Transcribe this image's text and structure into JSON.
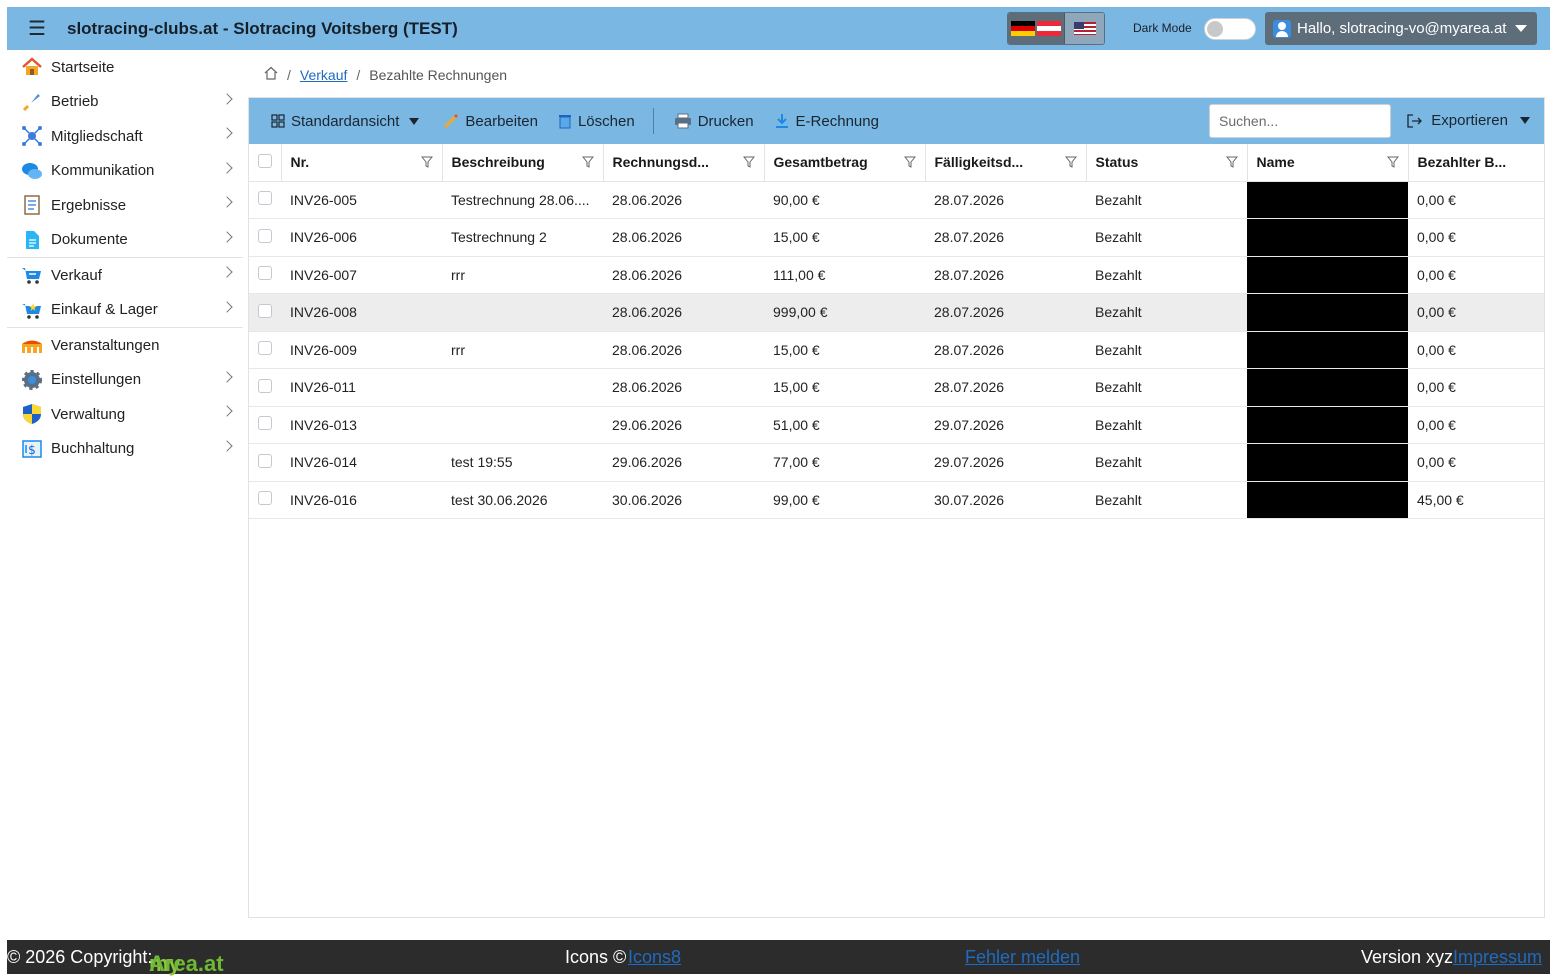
{
  "header": {
    "title": "slotracing-clubs.at - Slotracing Voitsberg (TEST)",
    "dark_mode_label": "Dark Mode",
    "user_label": "Hallo, slotracing-vo@myarea.at"
  },
  "sidebar": {
    "items": [
      {
        "label": "Startseite",
        "icon": "home-icon"
      },
      {
        "label": "Betrieb",
        "icon": "rocket-icon"
      },
      {
        "label": "Mitgliedschaft",
        "icon": "network-icon"
      },
      {
        "label": "Kommunikation",
        "icon": "chat-icon"
      },
      {
        "label": "Ergebnisse",
        "icon": "clipboard-icon"
      },
      {
        "label": "Dokumente",
        "icon": "document-icon"
      },
      {
        "label": "Verkauf",
        "icon": "cart-icon"
      },
      {
        "label": "Einkauf & Lager",
        "icon": "basket-icon"
      },
      {
        "label": "Veranstaltungen",
        "icon": "stadium-icon"
      },
      {
        "label": "Einstellungen",
        "icon": "gear-icon"
      },
      {
        "label": "Verwaltung",
        "icon": "shield-icon"
      },
      {
        "label": "Buchhaltung",
        "icon": "ledger-icon"
      }
    ]
  },
  "breadcrumb": {
    "parent": "Verkauf",
    "current": "Bezahlte Rechnungen"
  },
  "toolbar": {
    "view_label": "Standardansicht",
    "edit_label": "Bearbeiten",
    "delete_label": "Löschen",
    "print_label": "Drucken",
    "einvoice_label": "E-Rechnung",
    "search_placeholder": "Suchen...",
    "export_label": "Exportieren"
  },
  "table": {
    "columns": [
      "Nr.",
      "Beschreibung",
      "Rechnungsd...",
      "Gesamtbetrag",
      "Fälligkeitsd...",
      "Status",
      "Name",
      "Bezahlter B..."
    ],
    "rows": [
      {
        "nr": "INV26-005",
        "desc": "Testrechnung 28.06....",
        "date": "28.06.2026",
        "total": "90,00 €",
        "due": "28.07.2026",
        "status": "Bezahlt",
        "paid": "0,00 €"
      },
      {
        "nr": "INV26-006",
        "desc": "Testrechnung 2",
        "date": "28.06.2026",
        "total": "15,00 €",
        "due": "28.07.2026",
        "status": "Bezahlt",
        "paid": "0,00 €"
      },
      {
        "nr": "INV26-007",
        "desc": "rrr",
        "date": "28.06.2026",
        "total": "111,00 €",
        "due": "28.07.2026",
        "status": "Bezahlt",
        "paid": "0,00 €"
      },
      {
        "nr": "INV26-008",
        "desc": "",
        "date": "28.06.2026",
        "total": "999,00 €",
        "due": "28.07.2026",
        "status": "Bezahlt",
        "paid": "0,00 €"
      },
      {
        "nr": "INV26-009",
        "desc": "rrr",
        "date": "28.06.2026",
        "total": "15,00 €",
        "due": "28.07.2026",
        "status": "Bezahlt",
        "paid": "0,00 €"
      },
      {
        "nr": "INV26-011",
        "desc": "",
        "date": "28.06.2026",
        "total": "15,00 €",
        "due": "28.07.2026",
        "status": "Bezahlt",
        "paid": "0,00 €"
      },
      {
        "nr": "INV26-013",
        "desc": "",
        "date": "29.06.2026",
        "total": "51,00 €",
        "due": "29.07.2026",
        "status": "Bezahlt",
        "paid": "0,00 €"
      },
      {
        "nr": "INV26-014",
        "desc": "test 19:55",
        "date": "29.06.2026",
        "total": "77,00 €",
        "due": "29.07.2026",
        "status": "Bezahlt",
        "paid": "0,00 €"
      },
      {
        "nr": "INV26-016",
        "desc": "test 30.06.2026",
        "date": "30.06.2026",
        "total": "99,00 €",
        "due": "30.07.2026",
        "status": "Bezahlt",
        "paid": "45,00 €"
      }
    ]
  },
  "footer": {
    "copyright": "© 2026 Copyright:",
    "brand_my": "my",
    "brand_area": "Area.at",
    "icons_label": "Icons ©",
    "icons_link": "Icons8",
    "report_link": "Fehler melden",
    "version": "Version xyz",
    "imprint_link": "Impressum"
  }
}
